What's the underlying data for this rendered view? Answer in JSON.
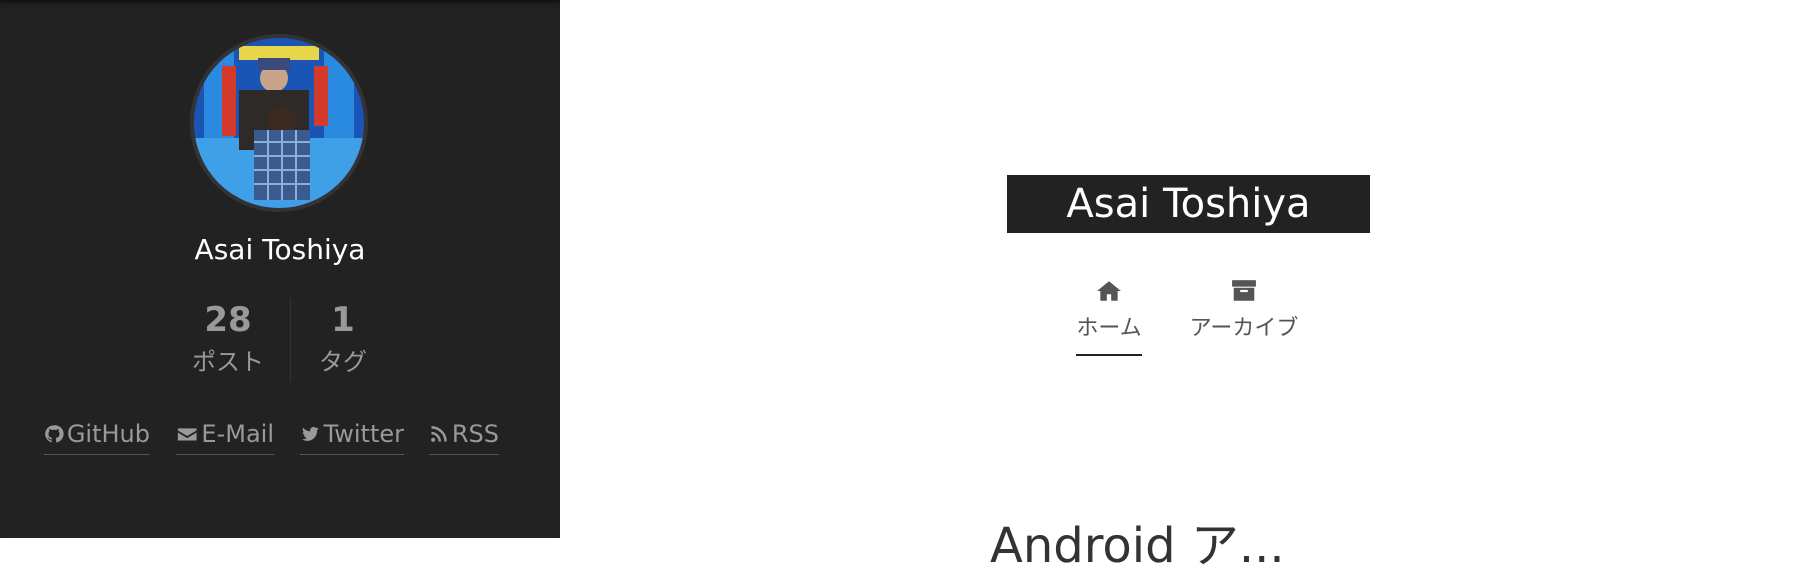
{
  "sidebar": {
    "author_name": "Asai Toshiya",
    "stats": [
      {
        "count": "28",
        "label": "ポスト"
      },
      {
        "count": "1",
        "label": "タグ"
      }
    ],
    "links": [
      {
        "label": "GitHub",
        "icon": "github-icon"
      },
      {
        "label": "E-Mail",
        "icon": "envelope-icon"
      },
      {
        "label": "Twitter",
        "icon": "twitter-icon"
      },
      {
        "label": "RSS",
        "icon": "rss-icon"
      }
    ]
  },
  "header": {
    "brand": "Asai Toshiya",
    "menu": [
      {
        "label": "ホーム",
        "icon": "home-icon",
        "active": true
      },
      {
        "label": "アーカイブ",
        "icon": "archive-icon",
        "active": false
      }
    ]
  },
  "post": {
    "title_partial": "Android ア..."
  },
  "colors": {
    "sidebar_bg": "#222222",
    "brand_bg": "#222222",
    "text_muted": "#999999"
  }
}
